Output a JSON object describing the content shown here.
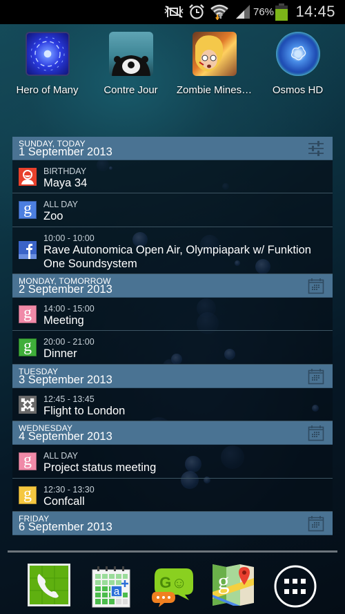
{
  "status_bar": {
    "icons": [
      "mute-vibrate-icon",
      "alarm-icon",
      "wifi-icon",
      "signal-icon",
      "battery-icon"
    ],
    "battery_percent": "76%",
    "battery_level": 0.76,
    "time": "14:45"
  },
  "home_apps": [
    {
      "label": "Hero of Many",
      "icon": "hero-of-many-icon"
    },
    {
      "label": "Contre Jour",
      "icon": "contre-jour-icon"
    },
    {
      "label": "Zombie Mines…",
      "icon": "zombie-minesweeper-icon"
    },
    {
      "label": "Osmos HD",
      "icon": "osmos-hd-icon"
    }
  ],
  "calendar_widget": {
    "days": [
      {
        "label": "SUNDAY, TODAY",
        "date": "1 September 2013",
        "header_icon": "settings-sliders-icon",
        "events": [
          {
            "time": "BIRTHDAY",
            "title": "Maya 34",
            "source": "birthday-contact-icon",
            "color": "#e8412c"
          },
          {
            "time": "ALL DAY",
            "title": "Zoo",
            "source": "google-calendar-icon",
            "color": "#4c7fe0"
          },
          {
            "time": "10:00 - 10:00",
            "title": "Rave Autonomica Open Air, Olympiapark w/ Funktion One Soundsystem",
            "source": "facebook-icon",
            "color": "#3b64c8"
          }
        ]
      },
      {
        "label": "MONDAY, TOMORROW",
        "date": "2 September 2013",
        "header_icon": "calendar-icon",
        "events": [
          {
            "time": "14:00 - 15:00",
            "title": "Meeting",
            "source": "google-calendar-icon",
            "color": "#f08aa8"
          },
          {
            "time": "20:00 - 21:00",
            "title": "Dinner",
            "source": "google-calendar-icon",
            "color": "#3fae3a"
          }
        ]
      },
      {
        "label": "TUESDAY",
        "date": "3 September 2013",
        "header_icon": "calendar-icon",
        "events": [
          {
            "time": "12:45 - 13:45",
            "title": "Flight to London",
            "source": "exchange-icon",
            "color": "#6a6a6a"
          }
        ]
      },
      {
        "label": "WEDNESDAY",
        "date": "4 September 2013",
        "header_icon": "calendar-icon",
        "events": [
          {
            "time": "ALL DAY",
            "title": "Project status meeting",
            "source": "google-calendar-icon",
            "color": "#f08aa8"
          },
          {
            "time": "12:30 - 13:30",
            "title": "Confcall",
            "source": "google-calendar-icon",
            "color": "#f5c740"
          }
        ]
      },
      {
        "label": "FRIDAY",
        "date": "6 September 2013",
        "header_icon": "calendar-icon",
        "events": []
      }
    ]
  },
  "dock": [
    {
      "name": "phone",
      "icon": "phone-icon"
    },
    {
      "name": "calendar",
      "icon": "calendar-app-icon"
    },
    {
      "name": "go-sms",
      "icon": "go-sms-icon",
      "text": "GO"
    },
    {
      "name": "maps",
      "icon": "maps-icon"
    },
    {
      "name": "app-drawer",
      "icon": "app-drawer-icon"
    }
  ],
  "colors": {
    "header_bg": "#4a7393",
    "event_bg": "#081620",
    "status_bar_bg": "#000000",
    "battery_fill": "#7cb518"
  }
}
